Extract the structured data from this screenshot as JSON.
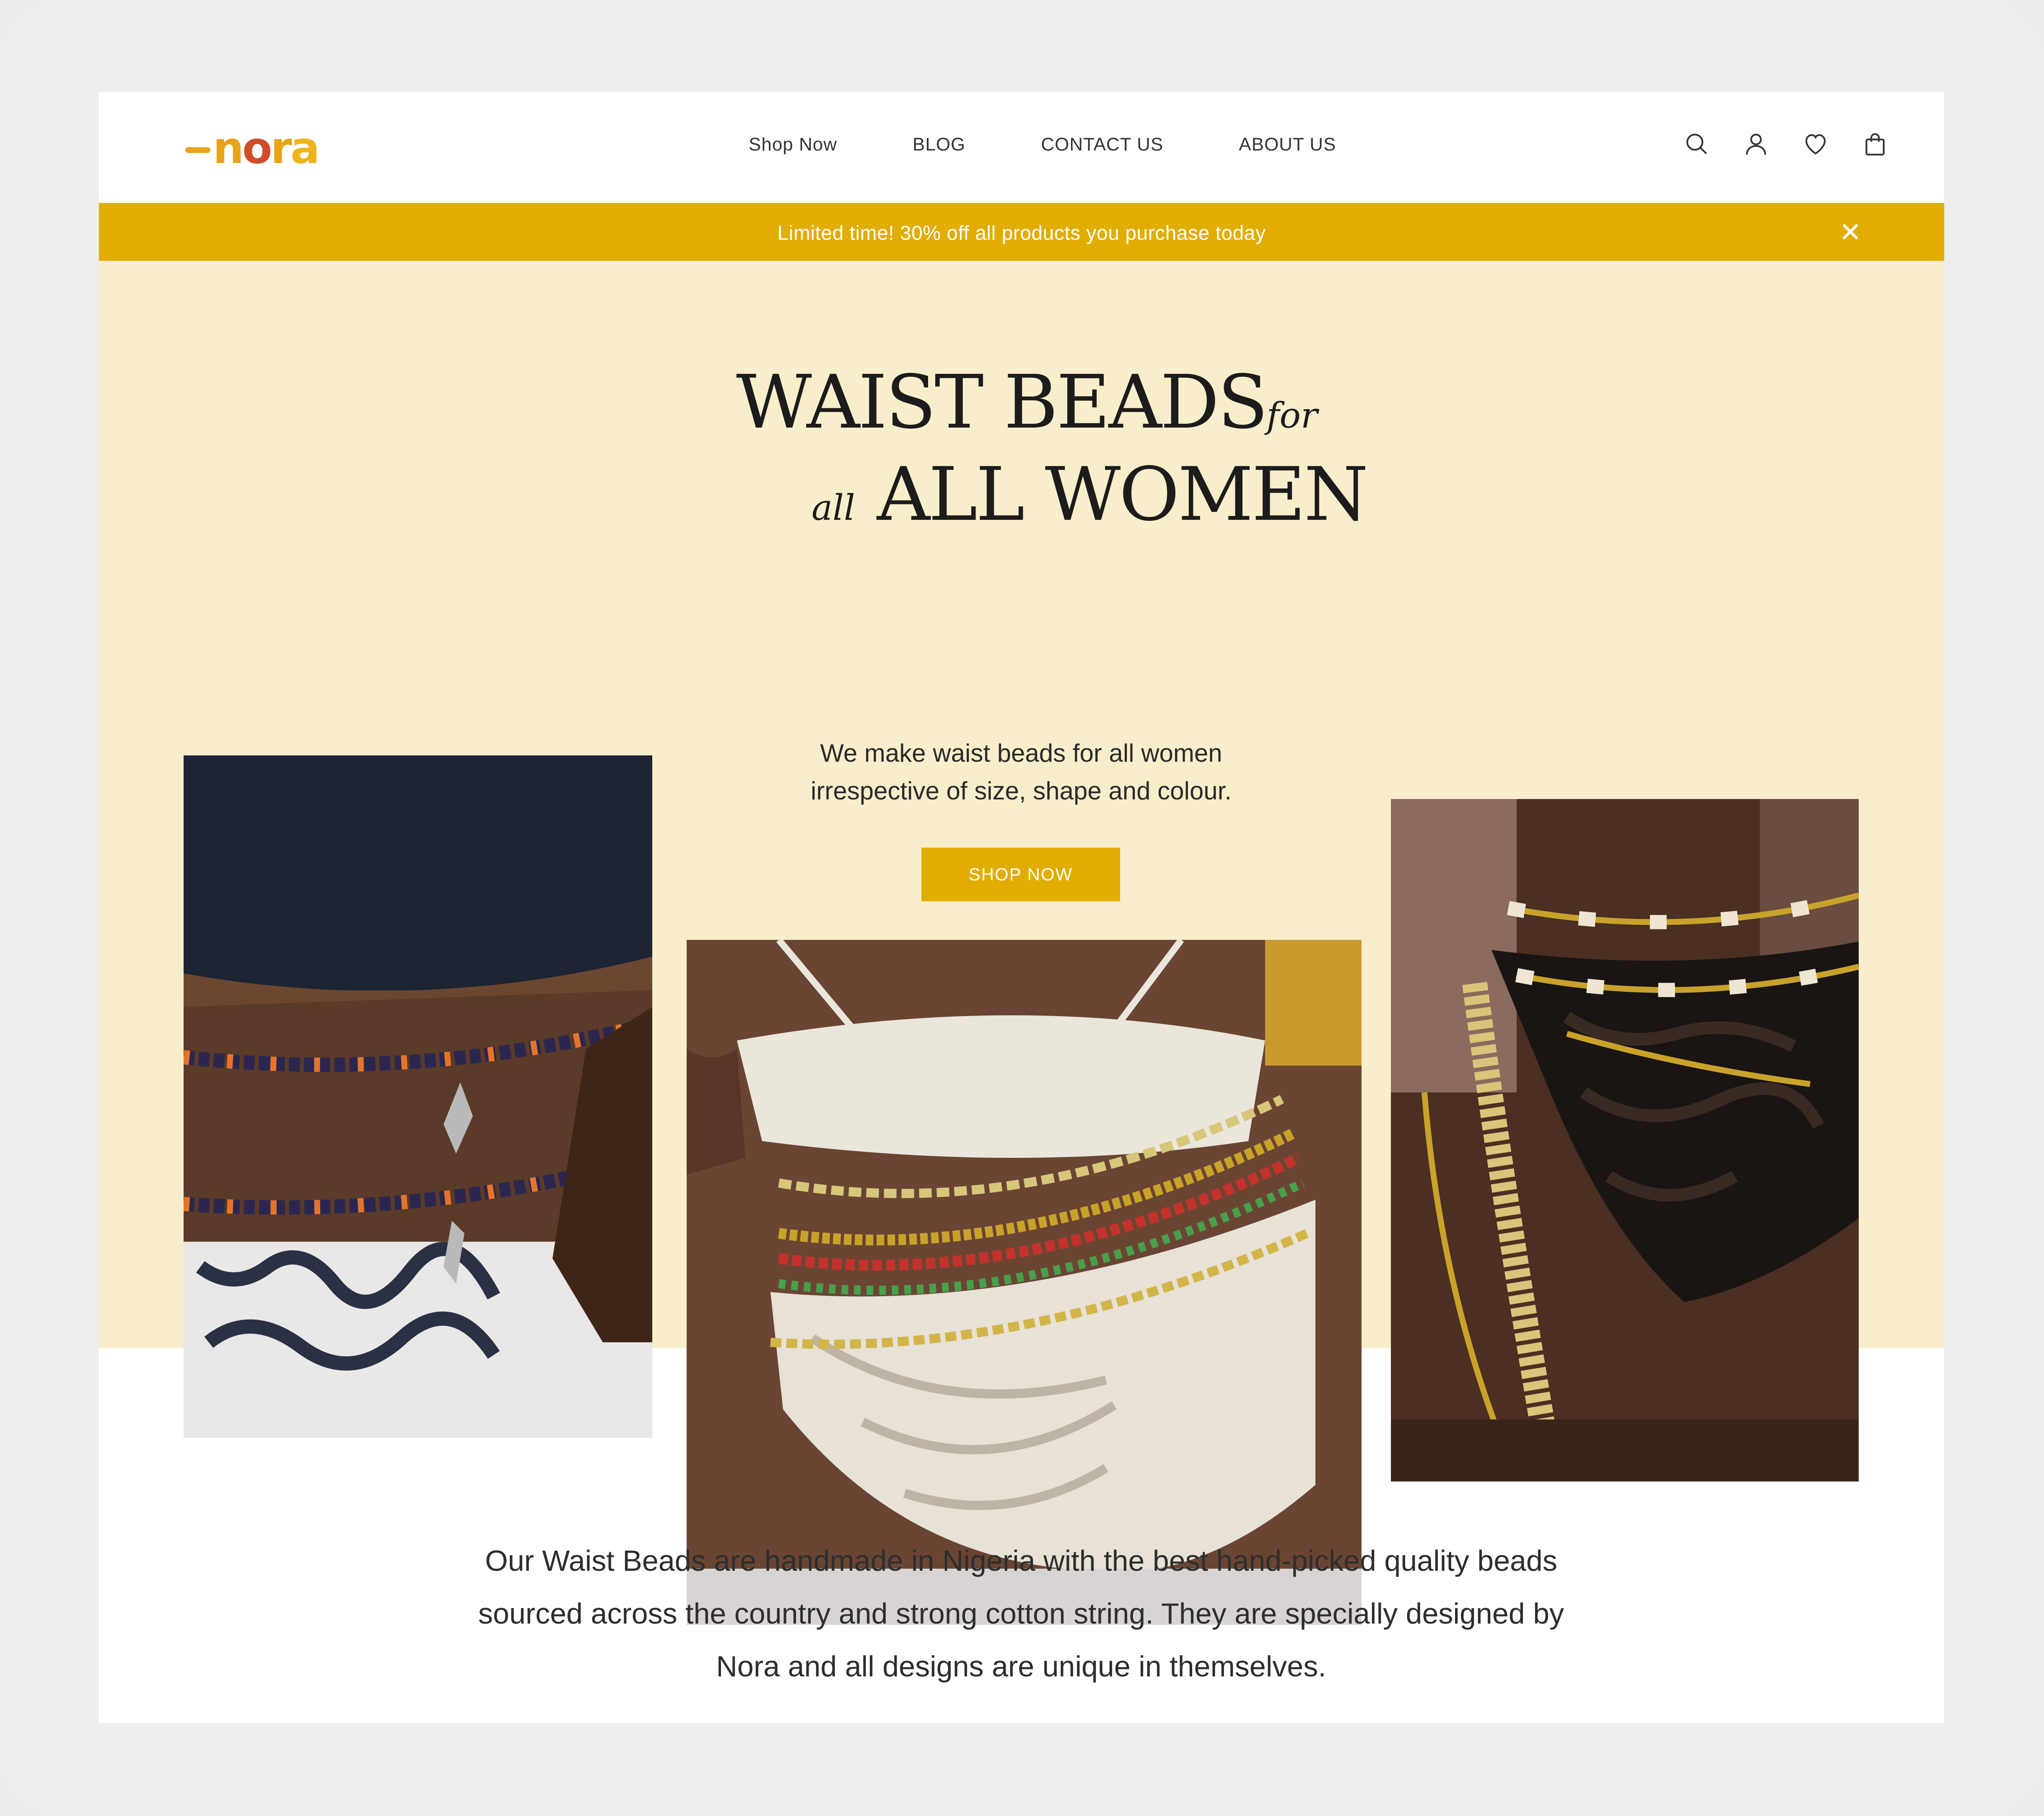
{
  "header": {
    "logo_text": "nora",
    "nav": [
      "Shop Now",
      "BLOG",
      "CONTACT US",
      "ABOUT US"
    ],
    "icons": [
      "search-icon",
      "user-icon",
      "heart-icon",
      "bag-icon"
    ]
  },
  "promo": {
    "text": "Limited time! 30% off all products you purchase today",
    "close": "✕"
  },
  "hero": {
    "title_line1": "WAIST BEADS",
    "title_line1_small": "for",
    "title_line2_small": "all",
    "title_line2": "ALL WOMEN",
    "subtitle_line1": "We make waist beads for all women",
    "subtitle_line2": "irrespective of size, shape and colour.",
    "cta": "SHOP NOW"
  },
  "about": {
    "line1": "Our Waist Beads are handmade in Nigeria with the best hand-picked quality beads",
    "line2": "sourced across the country and strong cotton string. They are specially designed by",
    "line3": "Nora and all designs are unique in themselves."
  },
  "colors": {
    "accent": "#e0ad00",
    "hero_bg": "#f8eecb",
    "text": "#1c1c1c"
  }
}
